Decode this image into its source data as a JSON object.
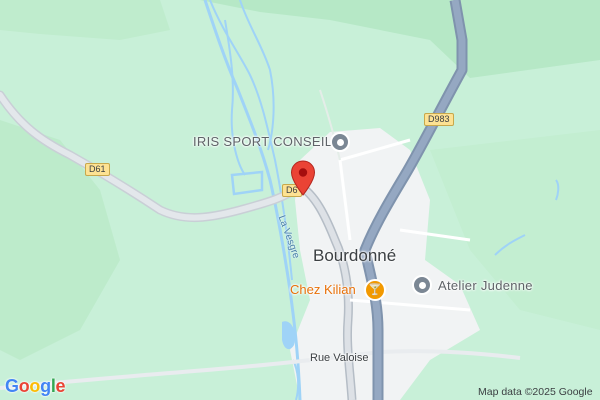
{
  "map": {
    "pois": {
      "iris": "IRIS SPORT CONSEIL",
      "atelier": "Atelier Judenne",
      "restaurant": "Chez Kilian"
    },
    "places": {
      "town": "Bourdonné"
    },
    "streets": {
      "rue_valoise": "Rue Valoise"
    },
    "water": {
      "river": "La Vesgre"
    },
    "road_shields": {
      "d61": "D61",
      "d983": "D983",
      "d6_partial": "D6"
    },
    "icons": {
      "poi": "poi-circle-icon",
      "restaurant": "cocktail-glass-icon",
      "pin": "map-pin-icon"
    },
    "colors": {
      "land": "#c8f0d8",
      "forest": "#b4e8c4",
      "town": "#f1f3f4",
      "water": "#aadaff",
      "highway": "#8ea2bd",
      "pin": "#ea4335"
    }
  },
  "footer": {
    "logo": "Google",
    "attribution": "Map data ©2025 Google"
  }
}
